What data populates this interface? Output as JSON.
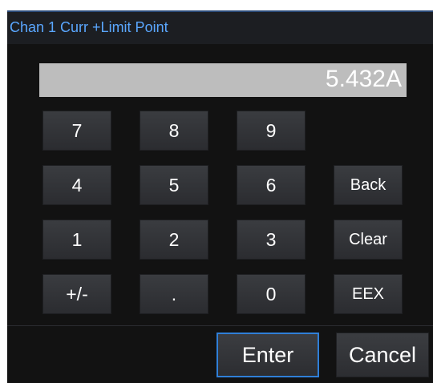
{
  "dialog": {
    "title": "Chan 1 Curr +Limit Point",
    "display_value": "5.432A"
  },
  "keypad": {
    "rows": [
      [
        "7",
        "8",
        "9",
        ""
      ],
      [
        "4",
        "5",
        "6",
        "Back"
      ],
      [
        "1",
        "2",
        "3",
        "Clear"
      ],
      [
        "+/-",
        ".",
        "0",
        "EEX"
      ]
    ]
  },
  "actions": {
    "enter_label": "Enter",
    "cancel_label": "Cancel"
  },
  "colors": {
    "title_text": "#5aa7ff",
    "enter_focus_border": "#2f7fd8",
    "display_background": "#bdbdbd"
  }
}
